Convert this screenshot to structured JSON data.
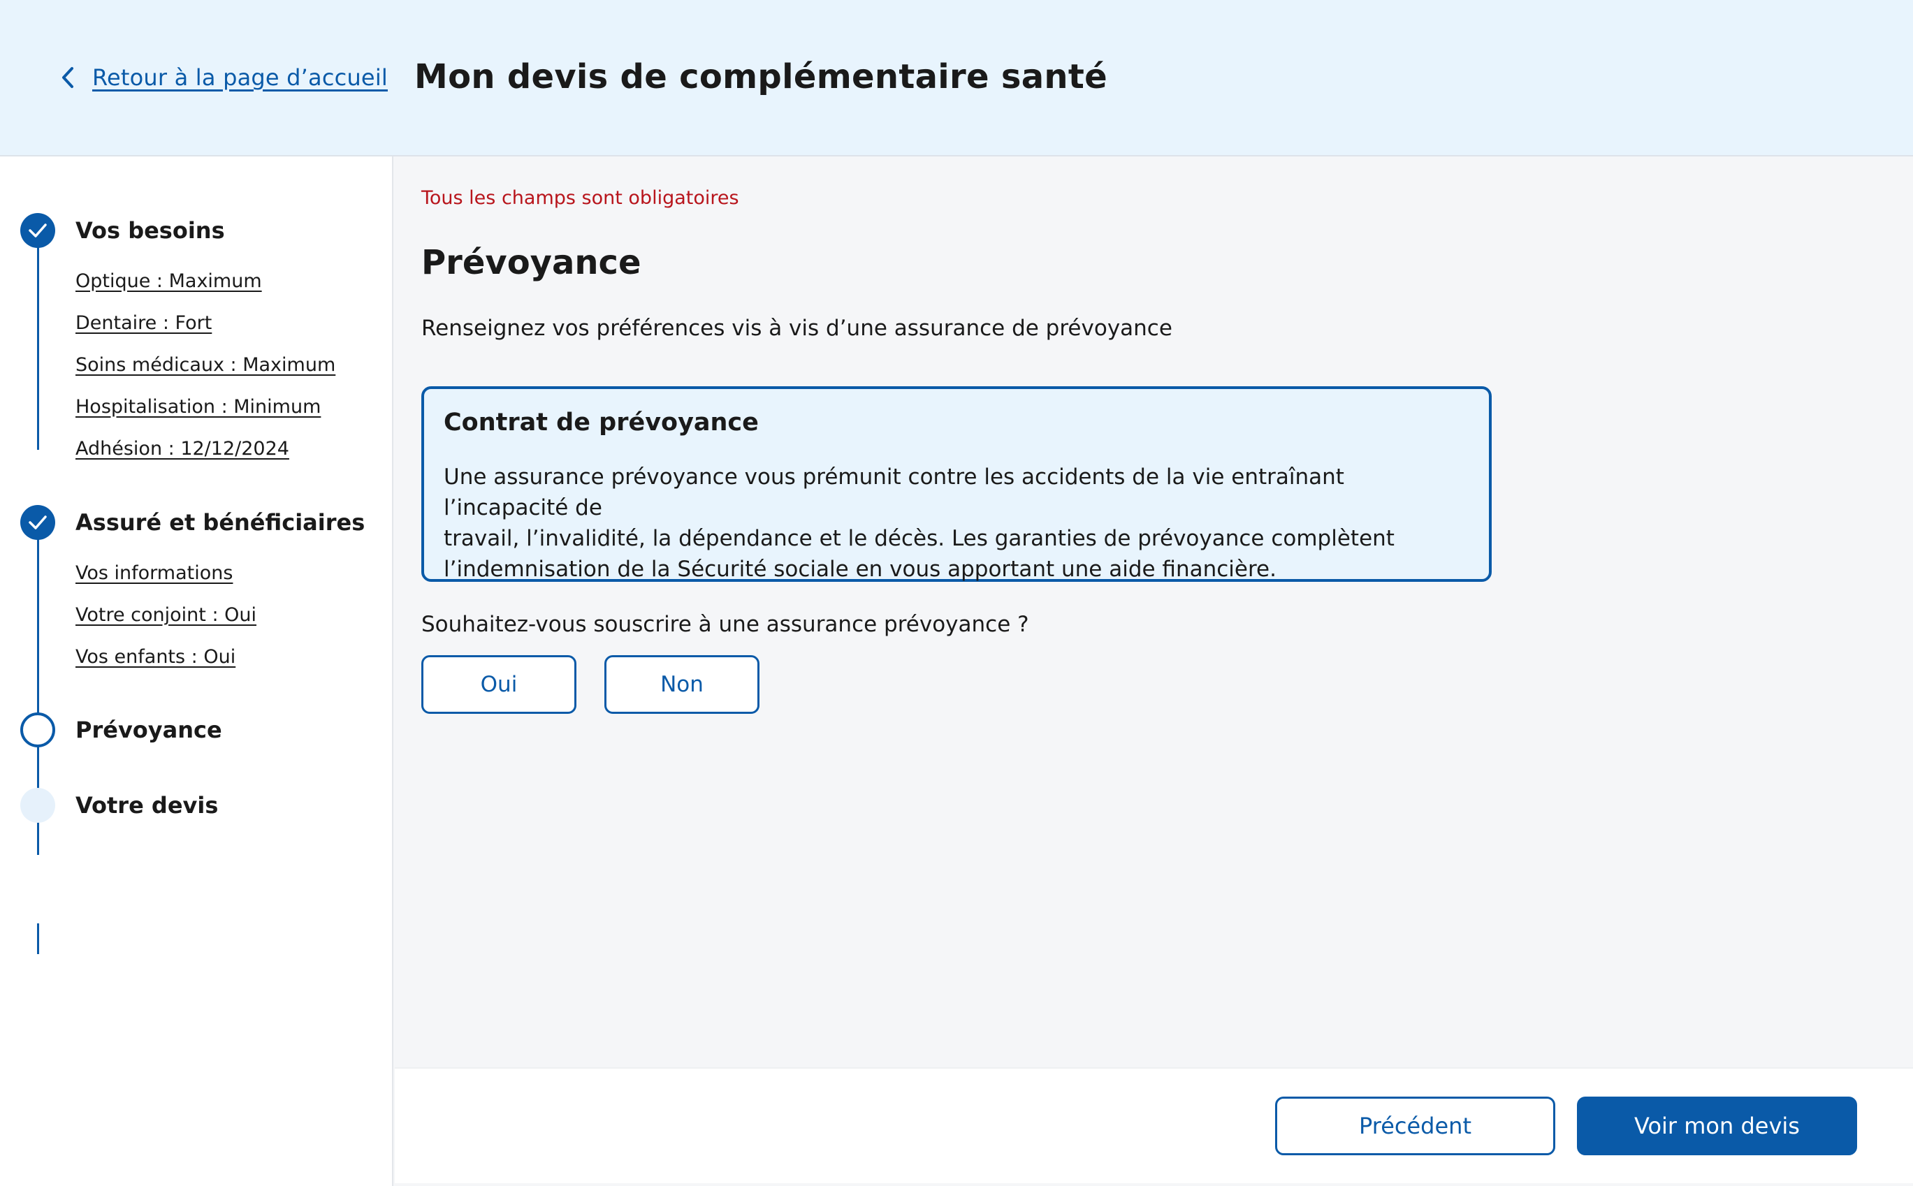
{
  "header": {
    "back_link": "Retour à la page d’accueil",
    "title": "Mon devis de complémentaire santé"
  },
  "sidebar": {
    "steps": [
      {
        "title": "Vos besoins",
        "status": "done",
        "items": [
          "Optique : Maximum",
          "Dentaire : Fort",
          "Soins médicaux : Maximum",
          "Hospitalisation : Minimum",
          "Adhésion : 12/12/2024"
        ]
      },
      {
        "title": "Assuré et bénéficiaires",
        "status": "done",
        "items": [
          "Vos informations",
          "Votre conjoint : Oui",
          "Vos enfants : Oui"
        ]
      },
      {
        "title": "Prévoyance",
        "status": "current",
        "items": []
      },
      {
        "title": "Votre devis",
        "status": "todo",
        "items": []
      }
    ]
  },
  "main": {
    "required_note": "Tous les champs sont obligatoires",
    "section_title": "Prévoyance",
    "intro": "Renseignez vos préférences vis à vis d’une assurance de prévoyance",
    "info_box": {
      "title": "Contrat de prévoyance",
      "text_lines": [
        "Une assurance prévoyance vous prémunit contre les accidents de la vie entraînant l’incapacité de",
        "travail, l’invalidité, la dépendance et le décès. Les garanties de prévoyance complètent",
        "l’indemnisation de la Sécurité sociale en vous apportant une aide financière."
      ]
    },
    "question": "Souhaitez-vous souscrire à une assurance prévoyance ?",
    "choices": {
      "yes": "Oui",
      "no": "Non"
    }
  },
  "footer": {
    "previous_label": "Précédent",
    "next_label": "Voir mon devis"
  },
  "colors": {
    "primary": "#0a5aa8",
    "header_bg": "#e8f4fd",
    "required_text": "#b8151c",
    "page_bg": "#f5f6f8"
  }
}
